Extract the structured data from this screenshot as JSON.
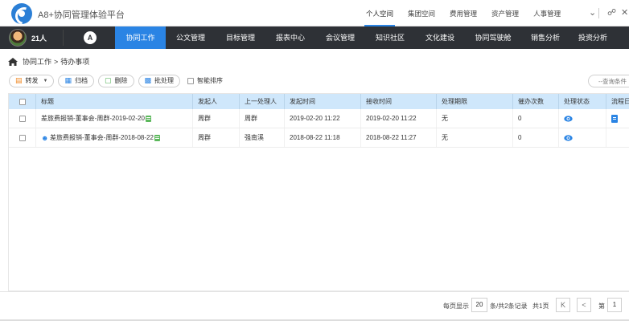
{
  "app": {
    "title": "A8+协同管理体验平台"
  },
  "top_nav": [
    {
      "label": "个人空间",
      "active": true
    },
    {
      "label": "集团空间",
      "active": false
    },
    {
      "label": "费用管理",
      "active": false
    },
    {
      "label": "资产管理",
      "active": false
    },
    {
      "label": "人事管理",
      "active": false
    }
  ],
  "user": {
    "count_label": "21人"
  },
  "main_nav": [
    {
      "label": "协同工作",
      "active": true
    },
    {
      "label": "公文管理",
      "active": false
    },
    {
      "label": "目标管理",
      "active": false
    },
    {
      "label": "报表中心",
      "active": false
    },
    {
      "label": "会议管理",
      "active": false
    },
    {
      "label": "知识社区",
      "active": false
    },
    {
      "label": "文化建设",
      "active": false
    },
    {
      "label": "协同驾驶舱",
      "active": false
    },
    {
      "label": "销售分析",
      "active": false
    },
    {
      "label": "投资分析",
      "active": false
    }
  ],
  "breadcrumb": {
    "section": "协同工作",
    "separator": ">",
    "page": "待办事项"
  },
  "toolbar": {
    "forward": "转发",
    "archive": "归档",
    "delete": "删除",
    "handled": "批处理",
    "smart_sort": "智能排序",
    "query_placeholder": "--查询条件"
  },
  "table": {
    "headers": [
      "标题",
      "发起人",
      "上一处理人",
      "发起时间",
      "接收时间",
      "处理期限",
      "催办次数",
      "处理状态",
      "流程日"
    ],
    "rows": [
      {
        "title": "差旅费报销-董事会-周群-2019-02-20",
        "sender": "周群",
        "prev": "周群",
        "start": "2019-02-20 11:22",
        "received": "2019-02-20 11:22",
        "deadline": "无",
        "reminders": "0"
      },
      {
        "title": "差旅费报销-董事会-周群-2018-08-22",
        "sender": "周群",
        "prev": "强南溪",
        "start": "2018-08-22 11:18",
        "received": "2018-08-22 11:27",
        "deadline": "无",
        "reminders": "0"
      }
    ]
  },
  "pager": {
    "per_page_label": "每页显示",
    "per_page": "20",
    "summary": "条/共2条记录",
    "total_pages": "共1页",
    "first": "K",
    "prev": "<",
    "page_prefix": "第",
    "page": "1"
  }
}
